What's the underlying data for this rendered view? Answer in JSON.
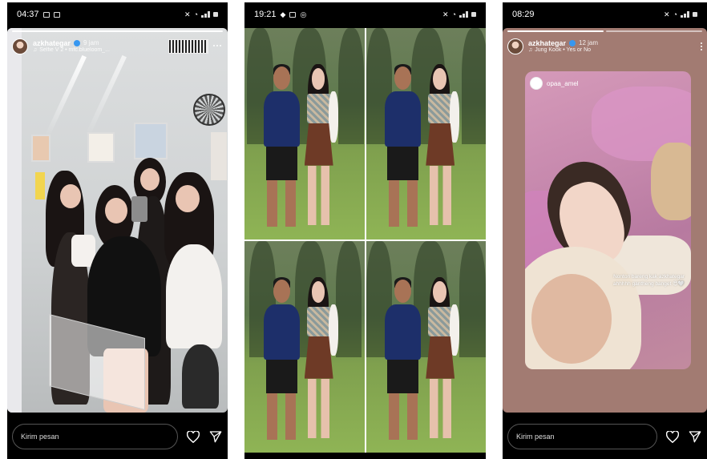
{
  "phones": [
    {
      "status_time": "04:37",
      "username": "azkhategar",
      "time_ago": "9 jam",
      "music": "Selfie V 2 • mfc.blueloom_...",
      "message_placeholder": "Kirim pesan"
    },
    {
      "status_time": "19:21"
    },
    {
      "status_time": "08:29",
      "username": "azkhategar",
      "time_ago": "12 jam",
      "music": "Jung Kook • Yes or No",
      "repost_username": "opaa_amel",
      "repost_caption": "Nonton bareng kak azkhategar ahhhhh gantheng banget 😍🤍",
      "message_placeholder": "Kirim pesan"
    }
  ],
  "icons": [
    "gallery-icon",
    "instagram-icon",
    "mute-icon",
    "wifi-icon",
    "signal-icon",
    "battery-icon",
    "verified-icon",
    "music-icon",
    "more-icon",
    "heart-icon",
    "send-icon"
  ],
  "colors": {
    "bg": "#000000",
    "verified": "#3797f0",
    "story3_bg": "#a27b72"
  }
}
